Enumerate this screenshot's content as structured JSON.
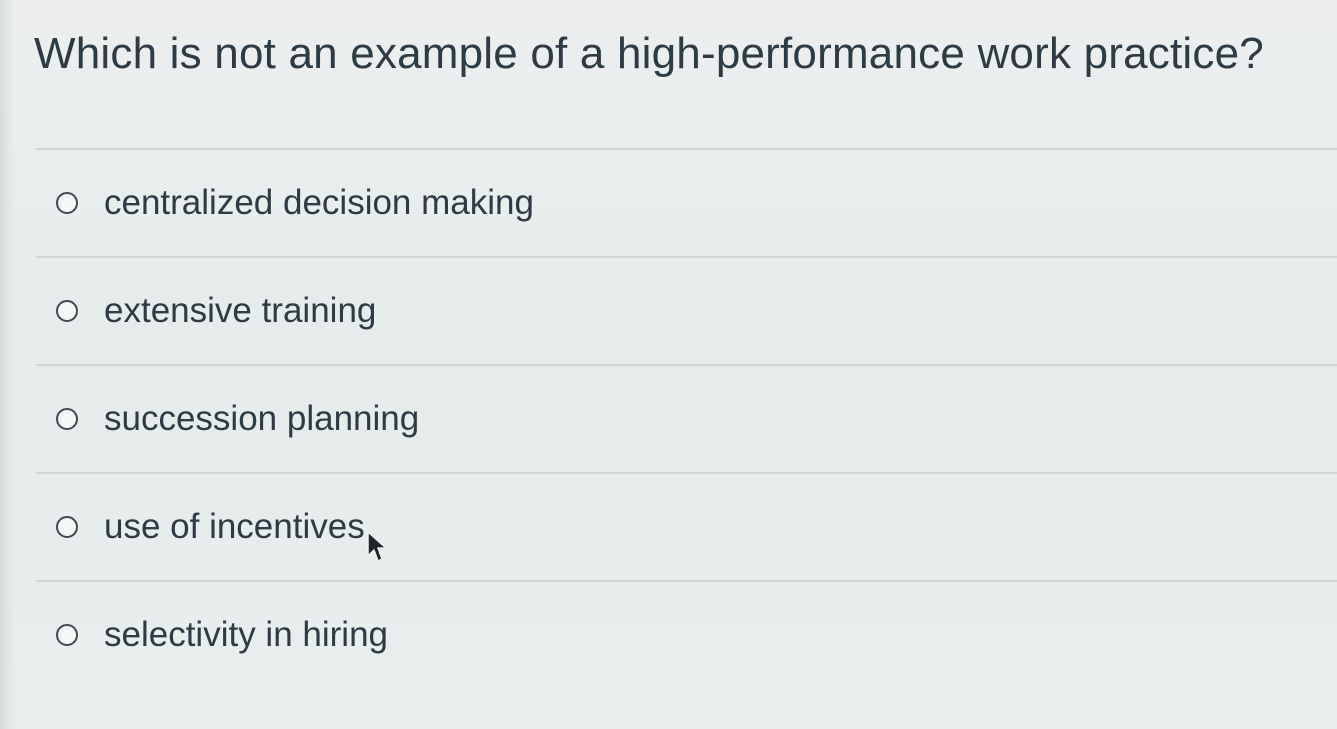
{
  "question": {
    "text": "Which is not an example of a high-performance work practice?"
  },
  "answers": [
    {
      "label": "centralized decision making",
      "selected": false
    },
    {
      "label": "extensive training",
      "selected": false
    },
    {
      "label": "succession planning",
      "selected": false
    },
    {
      "label": "use of incentives",
      "selected": false
    },
    {
      "label": "selectivity in hiring",
      "selected": false
    }
  ],
  "icons": {
    "radio": "radio-button-icon",
    "cursor": "mouse-pointer-icon"
  }
}
